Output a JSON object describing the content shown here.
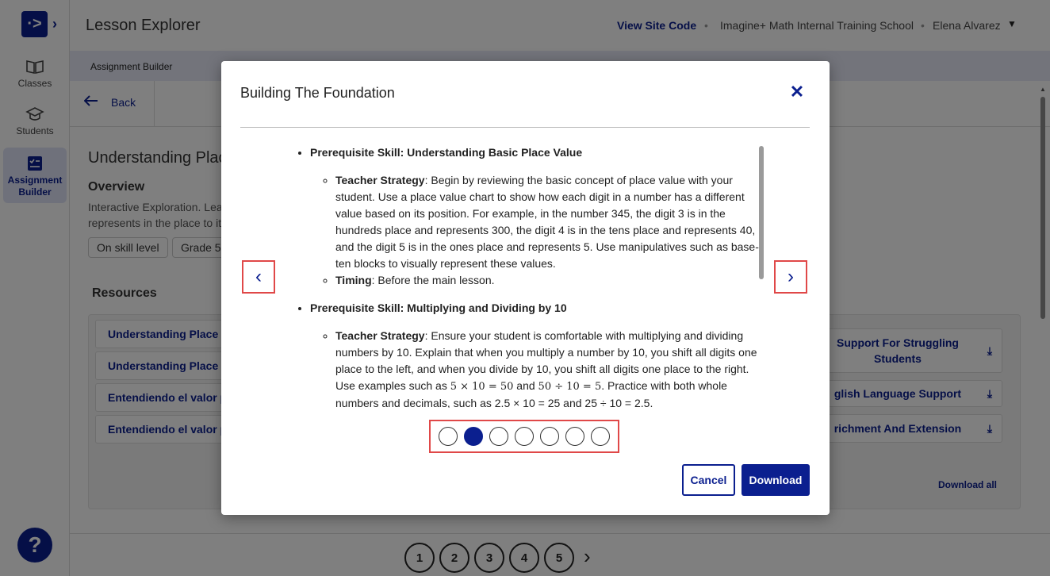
{
  "sidebar": {
    "logo_glyph": "·>",
    "expand_glyph": "›",
    "items": [
      {
        "label": "Classes"
      },
      {
        "label": "Students"
      },
      {
        "label": "Assignment Builder"
      }
    ],
    "help_glyph": "?"
  },
  "header": {
    "title": "Lesson Explorer",
    "view_site_code": "View Site Code",
    "school": "Imagine+ Math Internal Training School",
    "user": "Elena  Alvarez"
  },
  "breadcrumb": "Assignment Builder",
  "back_label": "Back",
  "lesson": {
    "title": "Understanding Plac",
    "overview_heading": "Overview",
    "overview_text": "Interactive Exploration. Lea represents in the place to it",
    "chips": [
      "On skill level",
      "Grade 5"
    ]
  },
  "resources": {
    "heading": "Resources",
    "left_items": [
      "Understanding Place V",
      "Understanding Place V",
      "Entendiendo el valor po",
      "Entendiendo el valor po"
    ],
    "right_items": [
      "Support For Struggling Students",
      "glish Language Support",
      "richment And Extension"
    ],
    "download_all": "Download all"
  },
  "pagination": {
    "pages": [
      "1",
      "2",
      "3",
      "4",
      "5"
    ],
    "next_glyph": "›"
  },
  "modal": {
    "title": "Building The Foundation",
    "close_glyph": "✕",
    "prev_glyph": "‹",
    "next_glyph": "›",
    "sections": [
      {
        "skill": "Prerequisite Skill: Understanding Basic Place Value",
        "strategy_label": "Teacher Strategy",
        "strategy_text": ": Begin by reviewing the basic concept of place value with your student. Use a place value chart to show how each digit in a number has a different value based on its position. For example, in the number 345, the digit 3 is in the hundreds place and represents 300, the digit 4 is in the tens place and represents 40, and the digit 5 is in the ones place and represents 5. Use manipulatives such as base-ten blocks to visually represent these values.",
        "timing_label": "Timing",
        "timing_text": ": Before the main lesson."
      },
      {
        "skill": "Prerequisite Skill: Multiplying and Dividing by 10",
        "strategy_label": "Teacher Strategy",
        "strategy_text_a": ": Ensure your student is comfortable with multiplying and dividing numbers by 10. Explain that when you multiply a number by 10, you shift all digits one place to the left, and when you divide by 10, you shift all digits one place to the right. Use examples such as ",
        "math_1": "5 × 10 = 50",
        "and_word": " and ",
        "math_2": "50 ÷ 10 = 5",
        "strategy_text_b": ". Practice with both whole numbers and decimals, such as 2.5 × 10 = 25 and 25 ÷ 10 = 2.5."
      }
    ],
    "slides_total": 7,
    "active_slide": 2,
    "cancel_label": "Cancel",
    "download_label": "Download"
  },
  "colors": {
    "brand": "#0b1f8f",
    "highlight": "#e04848"
  }
}
